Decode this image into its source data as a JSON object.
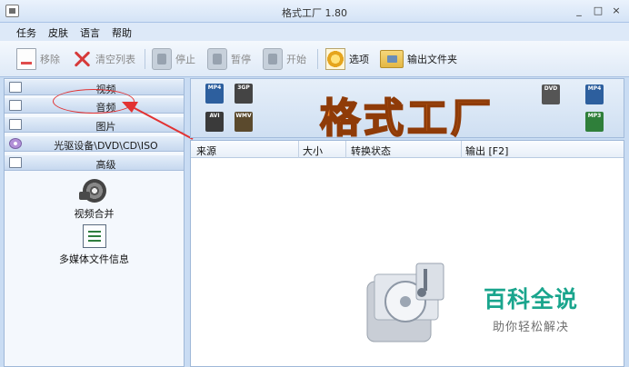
{
  "window": {
    "title": "格式工厂 1.80",
    "minimize_glyph": "_",
    "maximize_glyph": "□",
    "close_glyph": "×"
  },
  "menu": [
    "任务",
    "皮肤",
    "语言",
    "帮助"
  ],
  "toolbar": {
    "buttons": [
      {
        "label": "移除",
        "icon": "document-remove-icon",
        "enabled": false
      },
      {
        "label": "清空列表",
        "icon": "clear-list-icon",
        "enabled": false
      },
      {
        "label": "停止",
        "icon": "stop-icon",
        "enabled": false
      },
      {
        "label": "暂停",
        "icon": "pause-icon",
        "enabled": false
      },
      {
        "label": "开始",
        "icon": "start-icon",
        "enabled": false
      },
      {
        "label": "选项",
        "icon": "options-gear-icon",
        "enabled": true
      },
      {
        "label": "输出文件夹",
        "icon": "output-folder-icon",
        "enabled": true
      }
    ]
  },
  "sidebar": {
    "categories": [
      {
        "label": "视频",
        "icon": "video-icon"
      },
      {
        "label": "音频",
        "icon": "audio-icon"
      },
      {
        "label": "图片",
        "icon": "image-icon"
      },
      {
        "label": "光驱设备\\DVD\\CD\\ISO",
        "icon": "disc-icon"
      },
      {
        "label": "高级",
        "icon": "advanced-icon"
      }
    ],
    "tools": [
      {
        "label": "视频合并",
        "icon": "film-reel-icon"
      },
      {
        "label": "多媒体文件信息",
        "icon": "media-info-icon"
      }
    ]
  },
  "banner": {
    "logo_text": "格式工厂",
    "format_badges": [
      "MP4",
      "3GP",
      "AVI",
      "WMV",
      "DVD",
      "MP4",
      "MP3"
    ]
  },
  "task_table": {
    "columns": [
      "来源",
      "大小",
      "转换状态",
      "输出 [F2]"
    ],
    "rows": []
  },
  "watermark": {
    "title": "百科全说",
    "subtitle": "助你轻松解决"
  },
  "colors": {
    "accent_green": "#1aa58d",
    "logo_orange": "#fc8a26",
    "annotation_red": "#e23232"
  }
}
